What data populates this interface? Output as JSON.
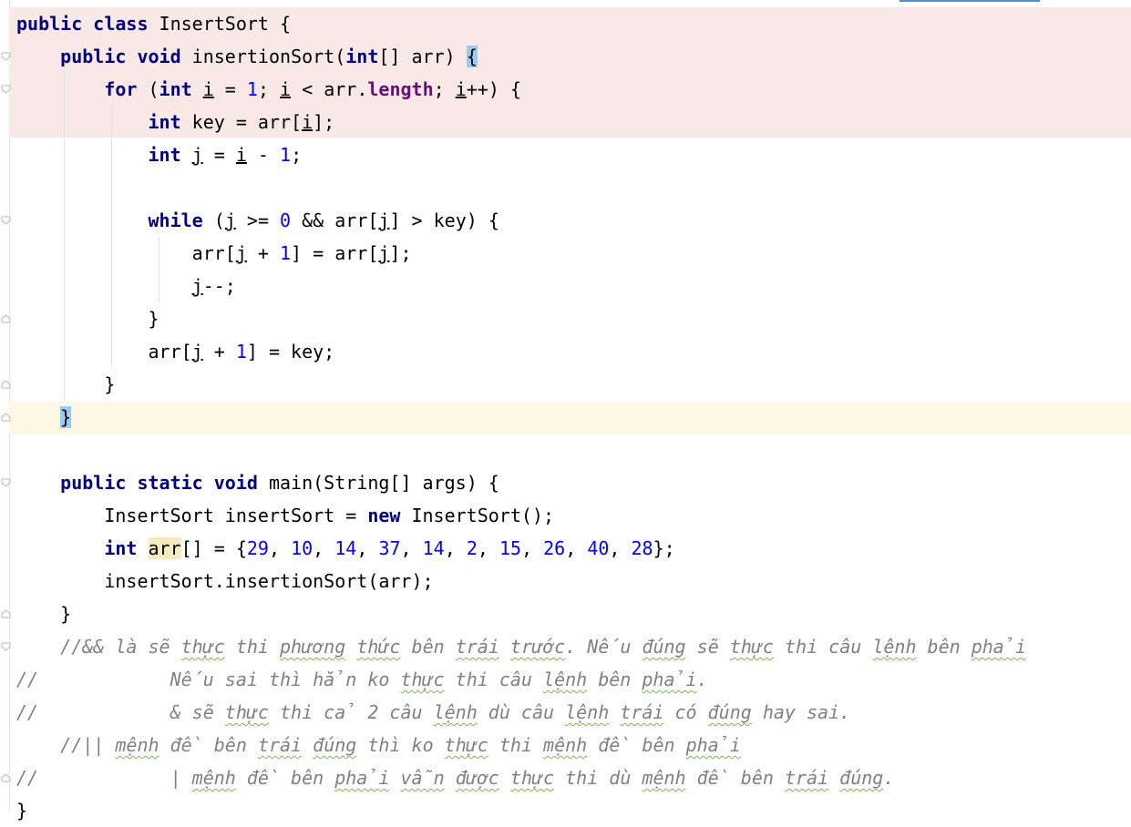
{
  "editor": {
    "lines": [
      [
        {
          "t": "public",
          "c": "kw"
        },
        {
          "t": " "
        },
        {
          "t": "class",
          "c": "kw"
        },
        {
          "t": " InsertSort {"
        }
      ],
      [
        {
          "t": "    "
        },
        {
          "t": "public",
          "c": "kw"
        },
        {
          "t": " "
        },
        {
          "t": "void",
          "c": "kw"
        },
        {
          "t": " insertionSort("
        },
        {
          "t": "int",
          "c": "kw"
        },
        {
          "t": "[] arr) "
        },
        {
          "t": "{",
          "c": "brace-hl"
        }
      ],
      [
        {
          "t": "        "
        },
        {
          "t": "for",
          "c": "kw"
        },
        {
          "t": " ("
        },
        {
          "t": "int",
          "c": "kw"
        },
        {
          "t": " "
        },
        {
          "t": "i",
          "c": "ul"
        },
        {
          "t": " = "
        },
        {
          "t": "1",
          "c": "num"
        },
        {
          "t": "; "
        },
        {
          "t": "i",
          "c": "ul"
        },
        {
          "t": " < arr."
        },
        {
          "t": "length",
          "c": "fld"
        },
        {
          "t": "; "
        },
        {
          "t": "i",
          "c": "ul"
        },
        {
          "t": "++) {"
        }
      ],
      [
        {
          "t": "            "
        },
        {
          "t": "int",
          "c": "kw"
        },
        {
          "t": " key = arr["
        },
        {
          "t": "i",
          "c": "ul"
        },
        {
          "t": "];"
        }
      ],
      [
        {
          "t": "            "
        },
        {
          "t": "int",
          "c": "kw"
        },
        {
          "t": " "
        },
        {
          "t": "j",
          "c": "ul"
        },
        {
          "t": " = "
        },
        {
          "t": "i",
          "c": "ul"
        },
        {
          "t": " - "
        },
        {
          "t": "1",
          "c": "num"
        },
        {
          "t": ";"
        }
      ],
      [
        {
          "t": ""
        }
      ],
      [
        {
          "t": "            "
        },
        {
          "t": "while",
          "c": "kw"
        },
        {
          "t": " ("
        },
        {
          "t": "j",
          "c": "ul"
        },
        {
          "t": " >= "
        },
        {
          "t": "0",
          "c": "num"
        },
        {
          "t": " && arr["
        },
        {
          "t": "j",
          "c": "ul"
        },
        {
          "t": "] > key) {"
        }
      ],
      [
        {
          "t": "                arr["
        },
        {
          "t": "j",
          "c": "ul"
        },
        {
          "t": " + "
        },
        {
          "t": "1",
          "c": "num"
        },
        {
          "t": "] = arr["
        },
        {
          "t": "j",
          "c": "ul"
        },
        {
          "t": "];"
        }
      ],
      [
        {
          "t": "                "
        },
        {
          "t": "j",
          "c": "ul"
        },
        {
          "t": "--;"
        }
      ],
      [
        {
          "t": "            }"
        }
      ],
      [
        {
          "t": "            arr["
        },
        {
          "t": "j",
          "c": "ul"
        },
        {
          "t": " + "
        },
        {
          "t": "1",
          "c": "num"
        },
        {
          "t": "] = key;"
        }
      ],
      [
        {
          "t": "        }"
        }
      ],
      [
        {
          "t": "    "
        },
        {
          "t": "}",
          "c": "brace-hl"
        }
      ],
      [
        {
          "t": ""
        }
      ],
      [
        {
          "t": "    "
        },
        {
          "t": "public",
          "c": "kw"
        },
        {
          "t": " "
        },
        {
          "t": "static",
          "c": "kw"
        },
        {
          "t": " "
        },
        {
          "t": "void",
          "c": "kw"
        },
        {
          "t": " main(String[] args) {"
        }
      ],
      [
        {
          "t": "        InsertSort insertSort = "
        },
        {
          "t": "new",
          "c": "kw"
        },
        {
          "t": " InsertSort();"
        }
      ],
      [
        {
          "t": "        "
        },
        {
          "t": "int",
          "c": "kw"
        },
        {
          "t": " "
        },
        {
          "t": "arr",
          "c": "var-hl"
        },
        {
          "t": "[] = {"
        },
        {
          "t": "29",
          "c": "num"
        },
        {
          "t": ", "
        },
        {
          "t": "10",
          "c": "num"
        },
        {
          "t": ", "
        },
        {
          "t": "14",
          "c": "num"
        },
        {
          "t": ", "
        },
        {
          "t": "37",
          "c": "num"
        },
        {
          "t": ", "
        },
        {
          "t": "14",
          "c": "num"
        },
        {
          "t": ", "
        },
        {
          "t": "2",
          "c": "num"
        },
        {
          "t": ", "
        },
        {
          "t": "15",
          "c": "num"
        },
        {
          "t": ", "
        },
        {
          "t": "26",
          "c": "num"
        },
        {
          "t": ", "
        },
        {
          "t": "40",
          "c": "num"
        },
        {
          "t": ", "
        },
        {
          "t": "28",
          "c": "num"
        },
        {
          "t": "};"
        }
      ],
      [
        {
          "t": "        insertSort.insertionSort(arr);"
        }
      ],
      [
        {
          "t": "    }"
        }
      ],
      [
        {
          "t": "    "
        },
        {
          "t": "//&& là sẽ ",
          "c": "cm"
        },
        {
          "t": "thực",
          "c": "cm sq"
        },
        {
          "t": " thi ",
          "c": "cm"
        },
        {
          "t": "phương",
          "c": "cm sq"
        },
        {
          "t": " ",
          "c": "cm"
        },
        {
          "t": "thức",
          "c": "cm sq"
        },
        {
          "t": " bên ",
          "c": "cm"
        },
        {
          "t": "trái",
          "c": "cm sq"
        },
        {
          "t": " ",
          "c": "cm"
        },
        {
          "t": "trước",
          "c": "cm sq"
        },
        {
          "t": ". Nếu ",
          "c": "cm"
        },
        {
          "t": "đúng",
          "c": "cm sq"
        },
        {
          "t": " sẽ ",
          "c": "cm"
        },
        {
          "t": "thực",
          "c": "cm sq"
        },
        {
          "t": " thi câu ",
          "c": "cm"
        },
        {
          "t": "lệnh",
          "c": "cm sq"
        },
        {
          "t": " bên ",
          "c": "cm"
        },
        {
          "t": "phải",
          "c": "cm sq"
        }
      ],
      [
        {
          "t": "//            Nếu sai thì hẳn ko ",
          "c": "cm"
        },
        {
          "t": "thực",
          "c": "cm sq"
        },
        {
          "t": " thi câu ",
          "c": "cm"
        },
        {
          "t": "lệnh",
          "c": "cm sq"
        },
        {
          "t": " bên ",
          "c": "cm"
        },
        {
          "t": "phải",
          "c": "cm sq"
        },
        {
          "t": ".",
          "c": "cm"
        }
      ],
      [
        {
          "t": "//            & sẽ ",
          "c": "cm"
        },
        {
          "t": "thực",
          "c": "cm sq"
        },
        {
          "t": " thi cả 2 câu ",
          "c": "cm"
        },
        {
          "t": "lệnh",
          "c": "cm sq"
        },
        {
          "t": " dù câu ",
          "c": "cm"
        },
        {
          "t": "lệnh",
          "c": "cm sq"
        },
        {
          "t": " ",
          "c": "cm"
        },
        {
          "t": "trái",
          "c": "cm sq"
        },
        {
          "t": " có ",
          "c": "cm"
        },
        {
          "t": "đúng",
          "c": "cm sq"
        },
        {
          "t": " hay sai.",
          "c": "cm"
        }
      ],
      [
        {
          "t": "    "
        },
        {
          "t": "//|| ",
          "c": "cm"
        },
        {
          "t": "mệnh",
          "c": "cm sq"
        },
        {
          "t": " đề bên ",
          "c": "cm"
        },
        {
          "t": "trái",
          "c": "cm sq"
        },
        {
          "t": " ",
          "c": "cm"
        },
        {
          "t": "đúng",
          "c": "cm sq"
        },
        {
          "t": " thì ko ",
          "c": "cm"
        },
        {
          "t": "thực",
          "c": "cm sq"
        },
        {
          "t": " thi ",
          "c": "cm"
        },
        {
          "t": "mệnh",
          "c": "cm sq"
        },
        {
          "t": " đề bên ",
          "c": "cm"
        },
        {
          "t": "phải",
          "c": "cm sq"
        }
      ],
      [
        {
          "t": "//            | ",
          "c": "cm"
        },
        {
          "t": "mệnh",
          "c": "cm sq"
        },
        {
          "t": " đề bên ",
          "c": "cm"
        },
        {
          "t": "phải",
          "c": "cm sq"
        },
        {
          "t": " ",
          "c": "cm"
        },
        {
          "t": "vẫn",
          "c": "cm sq"
        },
        {
          "t": " ",
          "c": "cm"
        },
        {
          "t": "được",
          "c": "cm sq"
        },
        {
          "t": " ",
          "c": "cm"
        },
        {
          "t": "thực",
          "c": "cm sq"
        },
        {
          "t": " thi dù ",
          "c": "cm"
        },
        {
          "t": "mệnh",
          "c": "cm sq"
        },
        {
          "t": " đề bên ",
          "c": "cm"
        },
        {
          "t": "trái",
          "c": "cm sq"
        },
        {
          "t": " ",
          "c": "cm"
        },
        {
          "t": "đúng",
          "c": "cm sq"
        },
        {
          "t": ".",
          "c": "cm"
        }
      ],
      [
        {
          "t": "}"
        }
      ]
    ],
    "fold_markers": [
      {
        "line": 1,
        "kind": "open"
      },
      {
        "line": 2,
        "kind": "open"
      },
      {
        "line": 6,
        "kind": "open"
      },
      {
        "line": 9,
        "kind": "close"
      },
      {
        "line": 11,
        "kind": "close"
      },
      {
        "line": 12,
        "kind": "close"
      },
      {
        "line": 14,
        "kind": "open"
      },
      {
        "line": 18,
        "kind": "close"
      },
      {
        "line": 19,
        "kind": "open"
      },
      {
        "line": 23,
        "kind": "close"
      }
    ]
  }
}
